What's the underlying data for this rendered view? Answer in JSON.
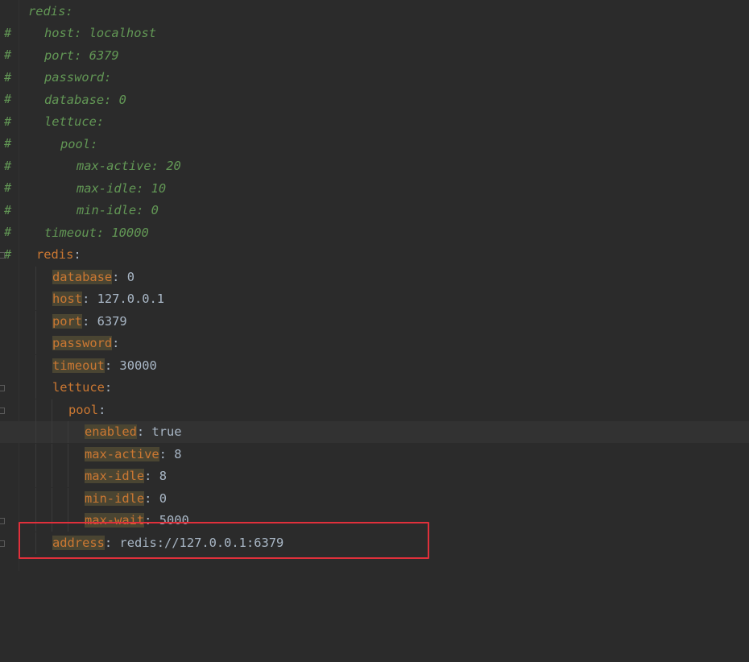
{
  "editor": {
    "comment_lines": [
      {
        "text": "redis:"
      },
      {
        "text": "host: localhost"
      },
      {
        "text": "port: 6379"
      },
      {
        "text": "password:"
      },
      {
        "text": "database: 0"
      },
      {
        "text": "lettuce:"
      },
      {
        "text": "pool:"
      },
      {
        "text": "max-active: 20"
      },
      {
        "text": "max-idle: 10"
      },
      {
        "text": "min-idle: 0"
      },
      {
        "text": "timeout: 10000"
      }
    ],
    "comment_marker": "#",
    "code_lines": [
      {
        "key": "redis",
        "sep": ":",
        "value": ""
      },
      {
        "key": "database",
        "sep": ":",
        "value": " 0"
      },
      {
        "key": "host",
        "sep": ":",
        "value": " 127.0.0.1"
      },
      {
        "key": "port",
        "sep": ":",
        "value": " 6379"
      },
      {
        "key": "password",
        "sep": ":",
        "value": ""
      },
      {
        "key": "timeout",
        "sep": ":",
        "value": " 30000"
      },
      {
        "key": "lettuce",
        "sep": ":",
        "value": ""
      },
      {
        "key": "pool",
        "sep": ":",
        "value": ""
      },
      {
        "key": "enabled",
        "sep": ":",
        "value": " true"
      },
      {
        "key": "max-active",
        "sep": ":",
        "value": " 8"
      },
      {
        "key": "max-idle",
        "sep": ":",
        "value": " 8"
      },
      {
        "key": "min-idle",
        "sep": ":",
        "value": " 0"
      },
      {
        "key": "max-wait",
        "sep": ":",
        "value": " 5000"
      },
      {
        "key": "address",
        "sep": ":",
        "value": " redis://127.0.0.1:6379"
      }
    ]
  },
  "colors": {
    "background": "#2b2b2b",
    "comment": "#629755",
    "key": "#cc7832",
    "text": "#a9b7c6",
    "annotation_box": "#e0303b"
  }
}
